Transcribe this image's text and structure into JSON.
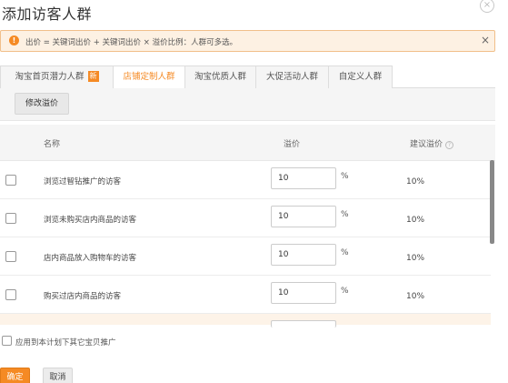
{
  "dialog": {
    "title": "添加访客人群",
    "close_glyph": "×"
  },
  "alert": {
    "icon_glyph": "!",
    "text": "出价 = 关键词出价 + 关键词出价 × 溢价比例：人群可多选。",
    "close_glyph": "×"
  },
  "tabs": [
    {
      "label": "淘宝首页潜力人群",
      "badge": "新"
    },
    {
      "label": "店铺定制人群"
    },
    {
      "label": "淘宝优质人群"
    },
    {
      "label": "大促活动人群"
    },
    {
      "label": "自定义人群"
    }
  ],
  "toolbar": {
    "modify_label": "修改溢价"
  },
  "table": {
    "headers": {
      "name": "名称",
      "premium": "溢价",
      "suggested": "建议溢价",
      "help_glyph": "?"
    },
    "rows": [
      {
        "name": "浏览过智钻推广的访客",
        "value": "10",
        "unit": "%",
        "suggested": "10%"
      },
      {
        "name": "浏览未购买店内商品的访客",
        "value": "10",
        "unit": "%",
        "suggested": "10%"
      },
      {
        "name": "店内商品放入购物车的访客",
        "value": "10",
        "unit": "%",
        "suggested": "10%"
      },
      {
        "name": "购买过店内商品的访客",
        "value": "10",
        "unit": "%",
        "suggested": "10%"
      }
    ]
  },
  "footer": {
    "apply_label": "应用到本计划下其它宝贝推广",
    "ok_label": "确定",
    "cancel_label": "取消"
  },
  "colors": {
    "accent": "#f58a24",
    "alert_bg": "#fdf1e3",
    "alert_border": "#f1bf8a"
  }
}
